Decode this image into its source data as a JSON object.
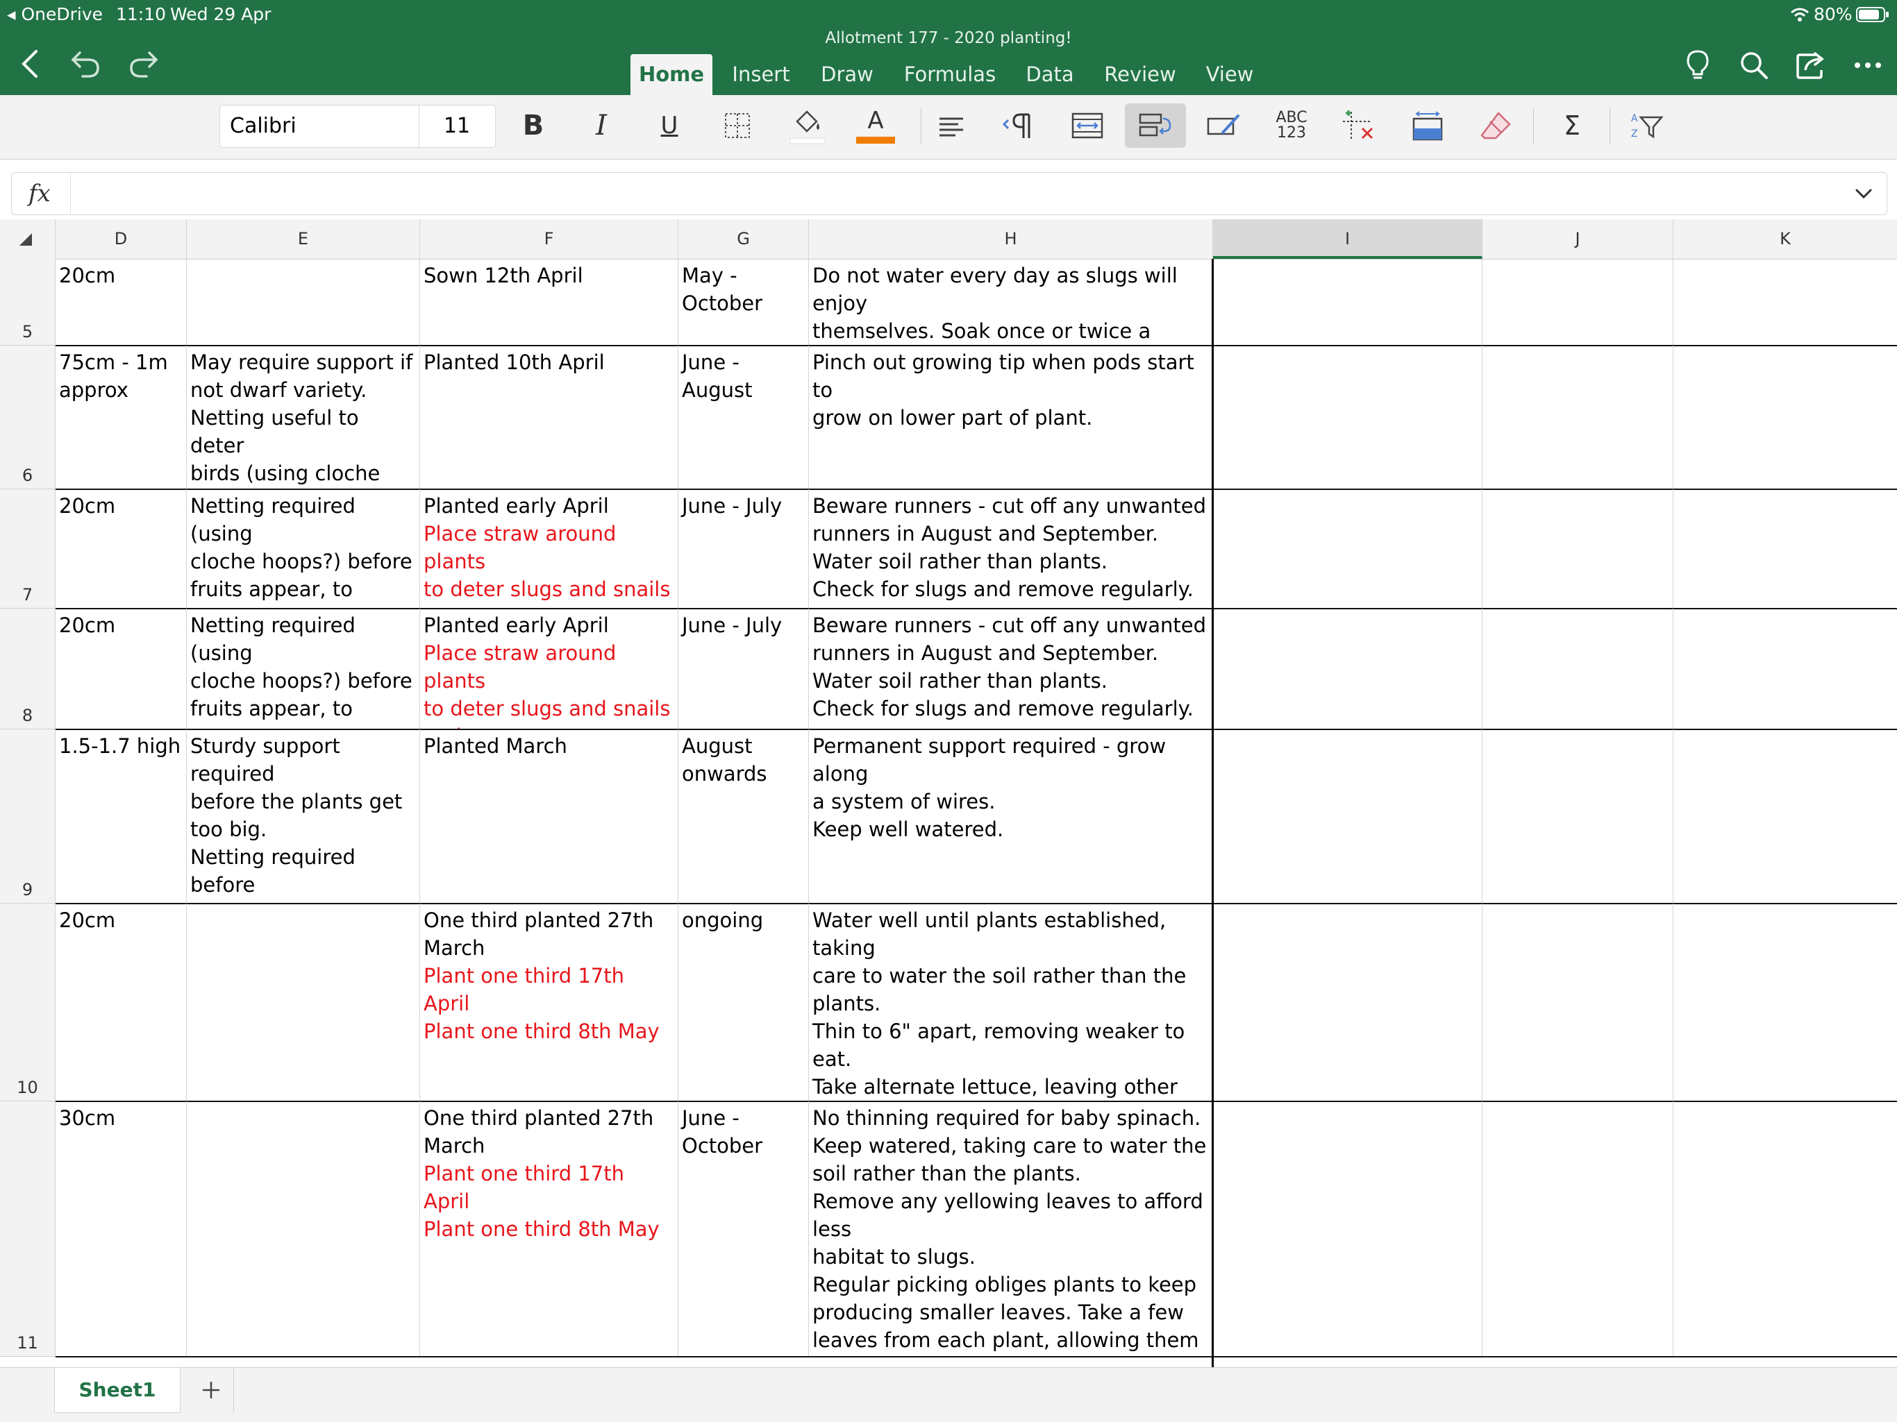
{
  "status_bar": {
    "back_app": "◂ OneDrive",
    "time": "11:10",
    "date": "Wed 29 Apr",
    "battery": "80%"
  },
  "document": {
    "title": "Allotment 177 - 2020 planting!"
  },
  "tabs": [
    {
      "label": "Home",
      "active": true
    },
    {
      "label": "Insert"
    },
    {
      "label": "Draw"
    },
    {
      "label": "Formulas"
    },
    {
      "label": "Data"
    },
    {
      "label": "Review"
    },
    {
      "label": "View"
    }
  ],
  "ribbon": {
    "font_name": "Calibri",
    "font_size": "11",
    "bold": "B",
    "italic": "I",
    "underline": "U",
    "font_color_letter": "A",
    "font_color": "#f07c00",
    "spelling_label_1": "ABC",
    "spelling_label_2": "123",
    "sum": "Σ"
  },
  "formula_bar": {
    "label": "fx",
    "value": ""
  },
  "columns": [
    "D",
    "E",
    "F",
    "G",
    "H",
    "I",
    "J",
    "K"
  ],
  "selected_column": "I",
  "rows": [
    {
      "num": "5",
      "D": "20cm",
      "E": "",
      "F": [
        {
          "t": "Sown 12th April"
        }
      ],
      "G": "May -\nOctober",
      "H": "Do not water every day as slugs will enjoy\nthemselves. Soak once or twice a week,\nwatering the soil rather than the plants."
    },
    {
      "num": "6",
      "D": "75cm - 1m\napprox",
      "E": "May require support if\nnot dwarf variety.\nNetting useful to deter\nbirds (using cloche\nhoops?).",
      "F": [
        {
          "t": "Planted 10th April"
        }
      ],
      "G": "June -\nAugust",
      "H": "Pinch out growing tip when pods start to\ngrow on lower part of plant."
    },
    {
      "num": "7",
      "D": "20cm",
      "E": "Netting required (using\ncloche hoops?) before\nfruits appear, to protect\nfrom birds.",
      "F": [
        {
          "t": "Planted early April"
        },
        {
          "t": "Place straw around plants\nto deter slugs and snails\nand protect strawberries.",
          "red": true
        }
      ],
      "G": "June - July",
      "H": "Beware runners - cut off any unwanted\nrunners in August and September.\nWater soil rather than plants.\nCheck for slugs and remove regularly."
    },
    {
      "num": "8",
      "D": "20cm",
      "E": "Netting required (using\ncloche hoops?) before\nfruits appear, to protect\nfrom birds.",
      "F": [
        {
          "t": "Planted early April"
        },
        {
          "t": "Place straw around plants\nto deter slugs and snails\nand protect strawberries.",
          "red": true
        }
      ],
      "G": "June - July",
      "H": "Beware runners - cut off any unwanted\nrunners in August and September.\nWater soil rather than plants.\nCheck for slugs and remove regularly."
    },
    {
      "num": "9",
      "D": "1.5-1.7 high",
      "E": "Sturdy support required\nbefore the plants get\ntoo big.\nNetting required before\nfruits appear, to protect\nfrom birds.",
      "F": [
        {
          "t": "Planted March"
        }
      ],
      "G": "August\nonwards",
      "H": "Permanent support required - grow along\na system of wires.\nKeep well watered."
    },
    {
      "num": "10",
      "D": "20cm",
      "E": "",
      "F": [
        {
          "t": "One third planted 27th\nMarch"
        },
        {
          "t": "Plant one third 17th April\nPlant one third 8th May",
          "red": true
        }
      ],
      "G": "ongoing",
      "H": "Water well until plants established, taking\ncare to water the soil rather than the\nplants.\nThin to 6\" apart, removing weaker to eat.\nTake alternate lettuce, leaving other heads\nto develop. Pick in cool of morning or\nevening."
    },
    {
      "num": "11",
      "D": "30cm",
      "E": "",
      "F": [
        {
          "t": "One third planted 27th\nMarch"
        },
        {
          "t": "Plant one third 17th April\nPlant one third 8th May",
          "red": true
        }
      ],
      "G": "June -\nOctober",
      "H": "No thinning required for baby spinach.\nKeep watered, taking care to water the\nsoil rather than the plants.\nRemove any yellowing leaves to afford less\nhabitat to slugs.\nRegular picking obliges plants to keep\nproducing smaller leaves. Take a few\nleaves from each plant, allowing them to\nregrow for two or three more pickings.."
    }
  ],
  "sheets": [
    {
      "label": "Sheet1",
      "active": true
    }
  ],
  "colors": {
    "brand_green": "#217346",
    "red_text": "#e8151a"
  }
}
